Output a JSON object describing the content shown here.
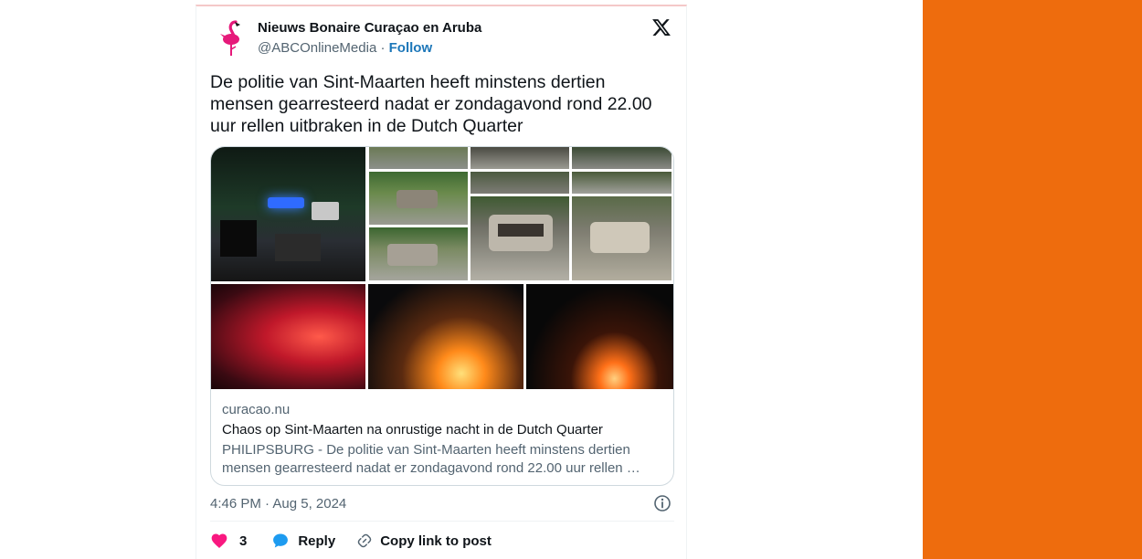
{
  "tweet": {
    "author_name": "Nieuws Bonaire Curaçao en Aruba",
    "handle": "@ABCOnlineMedia",
    "separator": " · ",
    "follow_label": "Follow",
    "text": "De politie van Sint-Maarten heeft minstens dertien mensen gearresteerd nadat er zondagavond rond 22.00 uur rellen uitbraken in de Dutch Quarter",
    "timestamp": "4:46 PM · Aug 5, 2024"
  },
  "link_card": {
    "domain": "curacao.nu",
    "title": "Chaos op Sint-Maarten na onrustige nacht in de Dutch Quarter",
    "description": "PHILIPSBURG - De politie van Sint-Maarten heeft minstens dertien mensen gearresteerd nadat er zondagavond rond 22.00 uur rellen …"
  },
  "actions": {
    "like_count": "3",
    "reply_label": "Reply",
    "copy_label": "Copy link to post"
  },
  "icons": {
    "avatar": "flamingo-logo",
    "brand": "x-logo",
    "info": "info-icon",
    "like": "heart-icon",
    "reply": "speech-bubble-icon",
    "copy": "link-icon"
  },
  "colors": {
    "accent_orange": "#ee6c0d",
    "follow_blue": "#1d77b9",
    "like_red": "#f91880",
    "reply_blue": "#1d9bf0"
  }
}
